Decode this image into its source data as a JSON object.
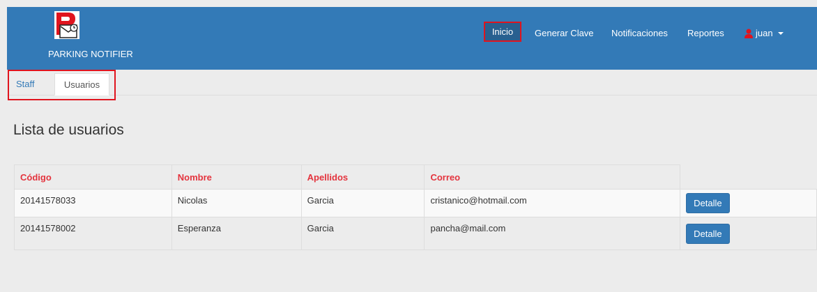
{
  "navbar": {
    "brand_text": "PARKING NOTIFIER",
    "links": {
      "inicio": "Inicio",
      "generar_clave": "Generar Clave",
      "notificaciones": "Notificaciones",
      "reportes": "Reportes"
    },
    "user": "juan",
    "icons": [
      "parking-notifier-logo",
      "user-icon",
      "caret-down-icon"
    ]
  },
  "tabs": [
    "Staff",
    "Usuarios"
  ],
  "title": "Lista de usuarios",
  "table": {
    "headers": [
      "Código",
      "Nombre",
      "Apellidos",
      "Correo"
    ],
    "rows": [
      {
        "codigo": "20141578033",
        "nombre": "Nicolas",
        "apellidos": "Garcia",
        "correo": "cristanico@hotmail.com",
        "action": "Detalle"
      },
      {
        "codigo": "20141578002",
        "nombre": "Esperanza",
        "apellidos": "Garcia",
        "correo": "pancha@mail.com",
        "action": "Detalle"
      }
    ]
  },
  "colors": {
    "navbar": "#337ab7",
    "header_text": "#e4333d",
    "highlight_border": "#e0141e"
  }
}
